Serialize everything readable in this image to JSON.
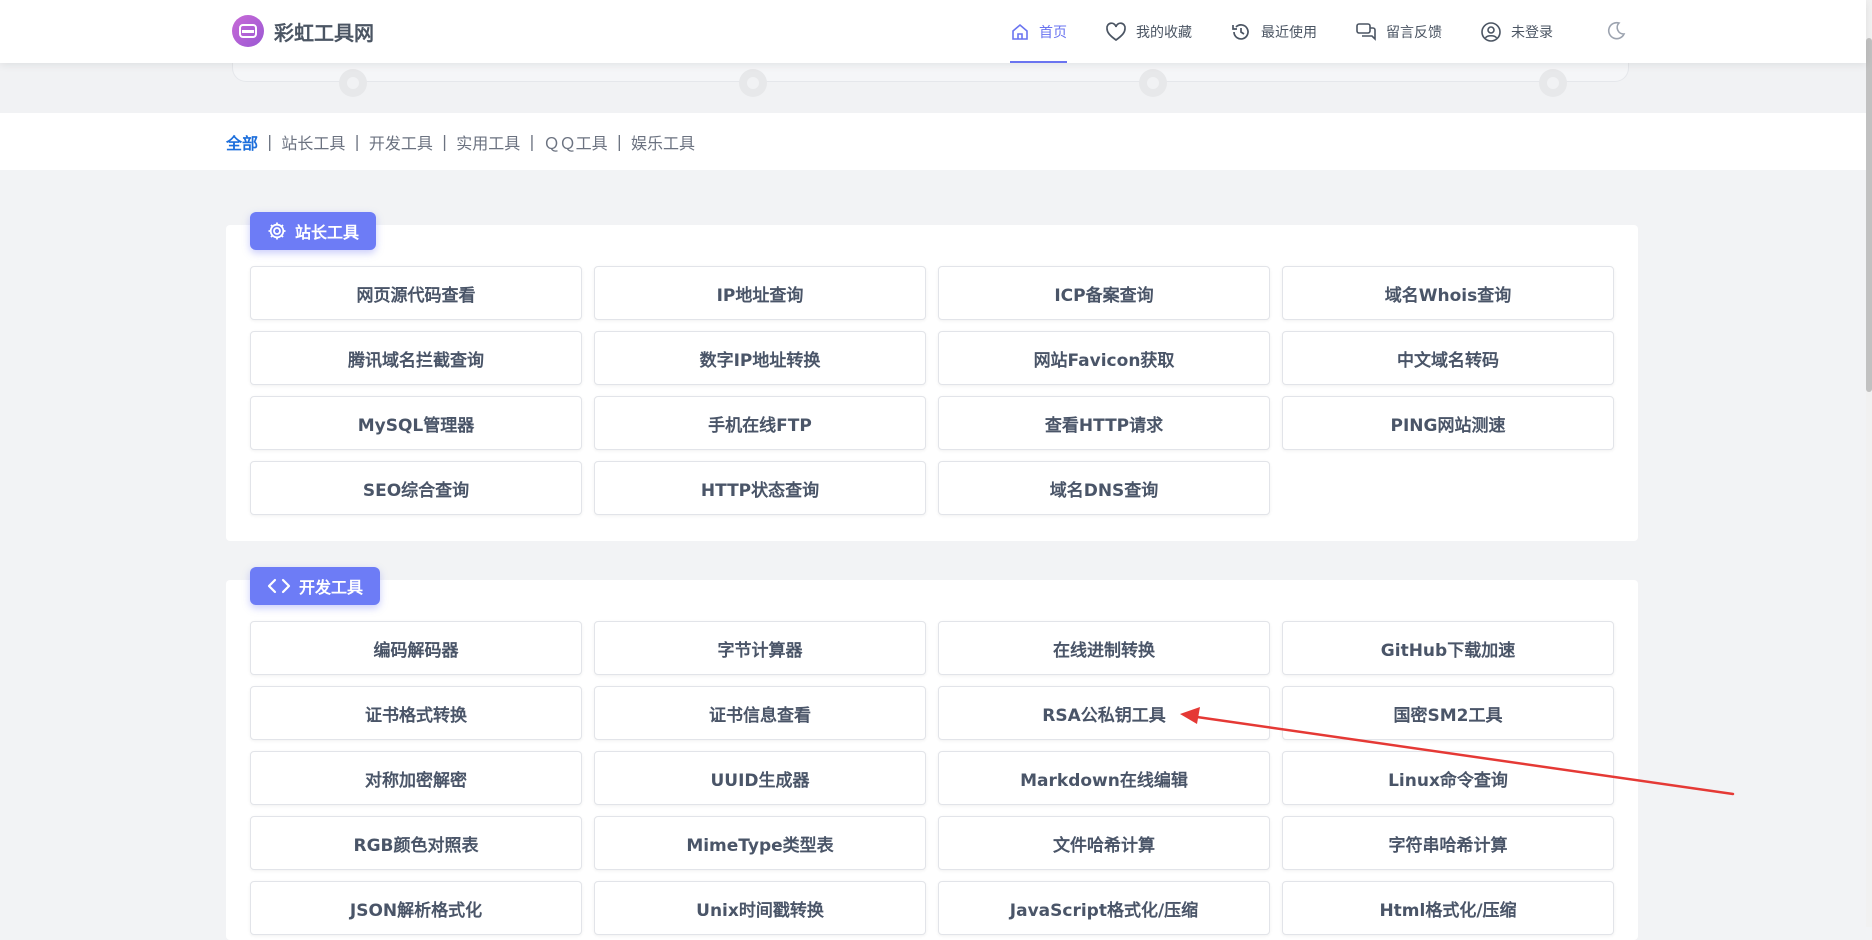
{
  "header": {
    "logo_text": "彩虹工具网",
    "nav": [
      {
        "label": "首页",
        "icon": "home-icon",
        "active": true
      },
      {
        "label": "我的收藏",
        "icon": "heart-icon"
      },
      {
        "label": "最近使用",
        "icon": "history-icon"
      },
      {
        "label": "留言反馈",
        "icon": "chat-icon"
      },
      {
        "label": "未登录",
        "icon": "user-icon"
      }
    ],
    "theme_toggle_icon": "moon-icon"
  },
  "filters": [
    "全部",
    "站长工具",
    "开发工具",
    "实用工具",
    "ＱＱ工具",
    "娱乐工具"
  ],
  "sections": [
    {
      "title": "站长工具",
      "icon": "gear-icon",
      "tools": [
        "网页源代码查看",
        "IP地址查询",
        "ICP备案查询",
        "域名Whois查询",
        "腾讯域名拦截查询",
        "数字IP地址转换",
        "网站Favicon获取",
        "中文域名转码",
        "MySQL管理器",
        "手机在线FTP",
        "查看HTTP请求",
        "PING网站测速",
        "SEO综合查询",
        "HTTP状态查询",
        "域名DNS查询"
      ]
    },
    {
      "title": "开发工具",
      "icon": "code-icon",
      "tools": [
        "编码解码器",
        "字节计算器",
        "在线进制转换",
        "GitHub下载加速",
        "证书格式转换",
        "证书信息查看",
        "RSA公私钥工具",
        "国密SM2工具",
        "对称加密解密",
        "UUID生成器",
        "Markdown在线编辑",
        "Linux命令查询",
        "RGB颜色对照表",
        "MimeType类型表",
        "文件哈希计算",
        "字符串哈希计算",
        "JSON解析格式化",
        "Unix时间戳转换",
        "JavaScript格式化/压缩",
        "Html格式化/压缩"
      ]
    }
  ],
  "colors": {
    "accent": "#6d7cf6",
    "active_filter": "#1d6fdc",
    "annotation_arrow": "#e53935"
  }
}
